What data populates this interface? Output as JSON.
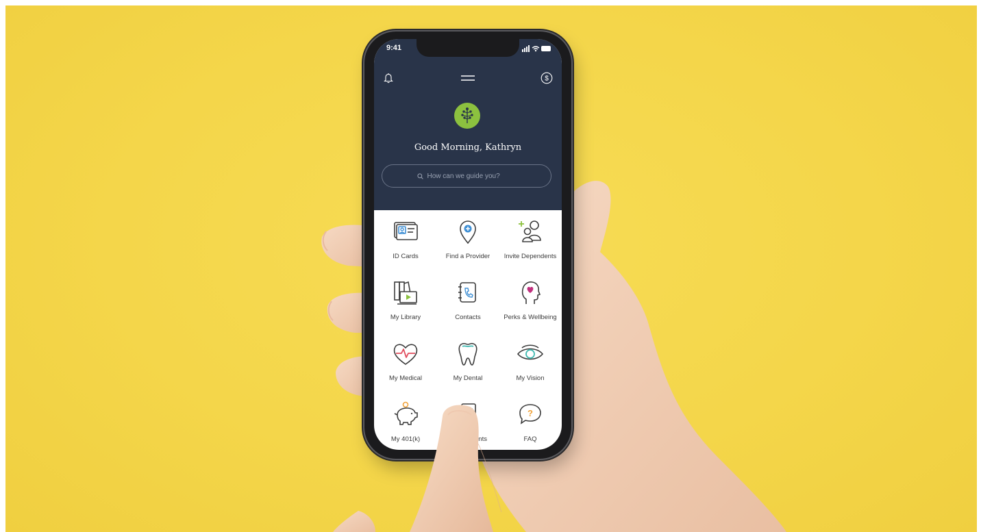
{
  "status_bar": {
    "time": "9:41"
  },
  "header": {
    "greeting": "Good Morning, Kathryn",
    "left_icon": "bell-icon",
    "center_icon": "menu-icon",
    "right_icon": "dollar-icon",
    "logo_icon": "tree-logo"
  },
  "search": {
    "placeholder": "How can we guide you?",
    "value": ""
  },
  "tiles": [
    {
      "label": "ID Cards",
      "icon": "id-card-icon"
    },
    {
      "label": "Find a Provider",
      "icon": "map-pin-icon"
    },
    {
      "label": "Invite Dependents",
      "icon": "add-person-icon"
    },
    {
      "label": "My Library",
      "icon": "library-icon"
    },
    {
      "label": "Contacts",
      "icon": "phone-book-icon"
    },
    {
      "label": "Perks & Wellbeing",
      "icon": "head-heart-icon"
    },
    {
      "label": "My Medical",
      "icon": "heart-pulse-icon"
    },
    {
      "label": "My Dental",
      "icon": "tooth-icon"
    },
    {
      "label": "My Vision",
      "icon": "eye-icon"
    },
    {
      "label": "My 401(k)",
      "icon": "piggy-bank-icon"
    },
    {
      "label": "ents",
      "icon": "document-icon"
    },
    {
      "label": "FAQ",
      "icon": "question-bubble-icon"
    }
  ],
  "colors": {
    "background": "#f5d84e",
    "header": "#293449",
    "accent_green": "#8cc13f",
    "icon_blue": "#3f8fd4",
    "icon_red": "#e04b5c",
    "icon_teal": "#3fb8b0",
    "icon_magenta": "#c0307e",
    "icon_orange": "#f0a23a"
  }
}
